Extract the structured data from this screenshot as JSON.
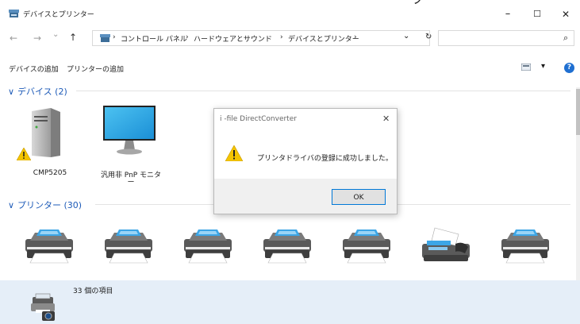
{
  "window": {
    "title": "デバイスとプリンター",
    "top_fragment": "ープ",
    "minimize": "–",
    "maximize": "☐",
    "close": "✕"
  },
  "nav": {
    "back": "←",
    "forward": "→",
    "recent": "⌄",
    "up": "↑",
    "breadcrumb": [
      "コントロール パネル",
      "ハードウェアとサウンド",
      "デバイスとプリンター"
    ],
    "separator": "›",
    "dropdown": "⌄",
    "refresh": "↻",
    "search_placeholder": "",
    "search_icon": "⌕"
  },
  "toolbar": {
    "add_device": "デバイスの追加",
    "add_printer": "プリンターの追加",
    "view_arrow": "▾",
    "help": "?"
  },
  "groups": {
    "devices": {
      "chevron": "∨",
      "header": "デバイス (2)"
    },
    "printers": {
      "chevron": "∨",
      "header": "プリンター (30)"
    }
  },
  "devices": [
    {
      "label": "CMP5205",
      "icon": "computer-icon",
      "warning": true
    },
    {
      "label": "汎用非 PnP モニタ",
      "label2": "ー",
      "icon": "monitor-icon"
    }
  ],
  "printers": [
    {
      "icon": "printer-icon"
    },
    {
      "icon": "printer-icon"
    },
    {
      "icon": "printer-icon"
    },
    {
      "icon": "printer-icon"
    },
    {
      "icon": "printer-icon"
    },
    {
      "icon": "fax-icon"
    },
    {
      "icon": "printer-icon"
    }
  ],
  "status": {
    "count": "33 個の項目"
  },
  "dialog": {
    "title": "i -file DirectConverter",
    "close": "✕",
    "message": "プリンタドライバの登録に成功しました。",
    "ok": "OK"
  },
  "colors": {
    "accent": "#0078d7",
    "group_header": "#1e5bb8",
    "status_bar": "#e5eef8",
    "warning": "#f4c400"
  }
}
